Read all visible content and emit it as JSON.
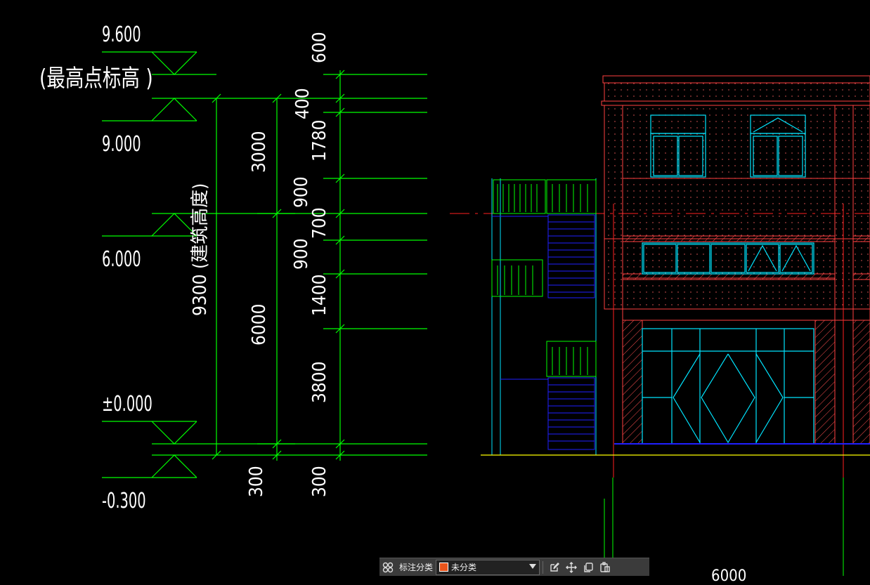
{
  "colors": {
    "background": "#000000",
    "dimension": "#00ff00",
    "wall": "#ff4040",
    "window": "#00e5ff",
    "stair": "#2020ff",
    "railing": "#00ff00",
    "ground": "#ffff00",
    "text": "#ffffff"
  },
  "levels": {
    "top": "9.600",
    "top_note": "(最高点标高    )",
    "roof": "9.000",
    "floor2": "6.000",
    "ground": "±0.000",
    "base": "-0.300"
  },
  "dimensions": {
    "total": "9300 (建筑高度)",
    "col2": [
      "3000",
      "6000",
      "300"
    ],
    "col3": [
      "600",
      "400",
      "1780",
      "900",
      "700",
      "900",
      "1400",
      "3800",
      "300"
    ],
    "bottom_partial": "6000"
  },
  "toolbar": {
    "label": "标注分类",
    "selected": "未分类",
    "swatch_color": "#e8541b"
  }
}
